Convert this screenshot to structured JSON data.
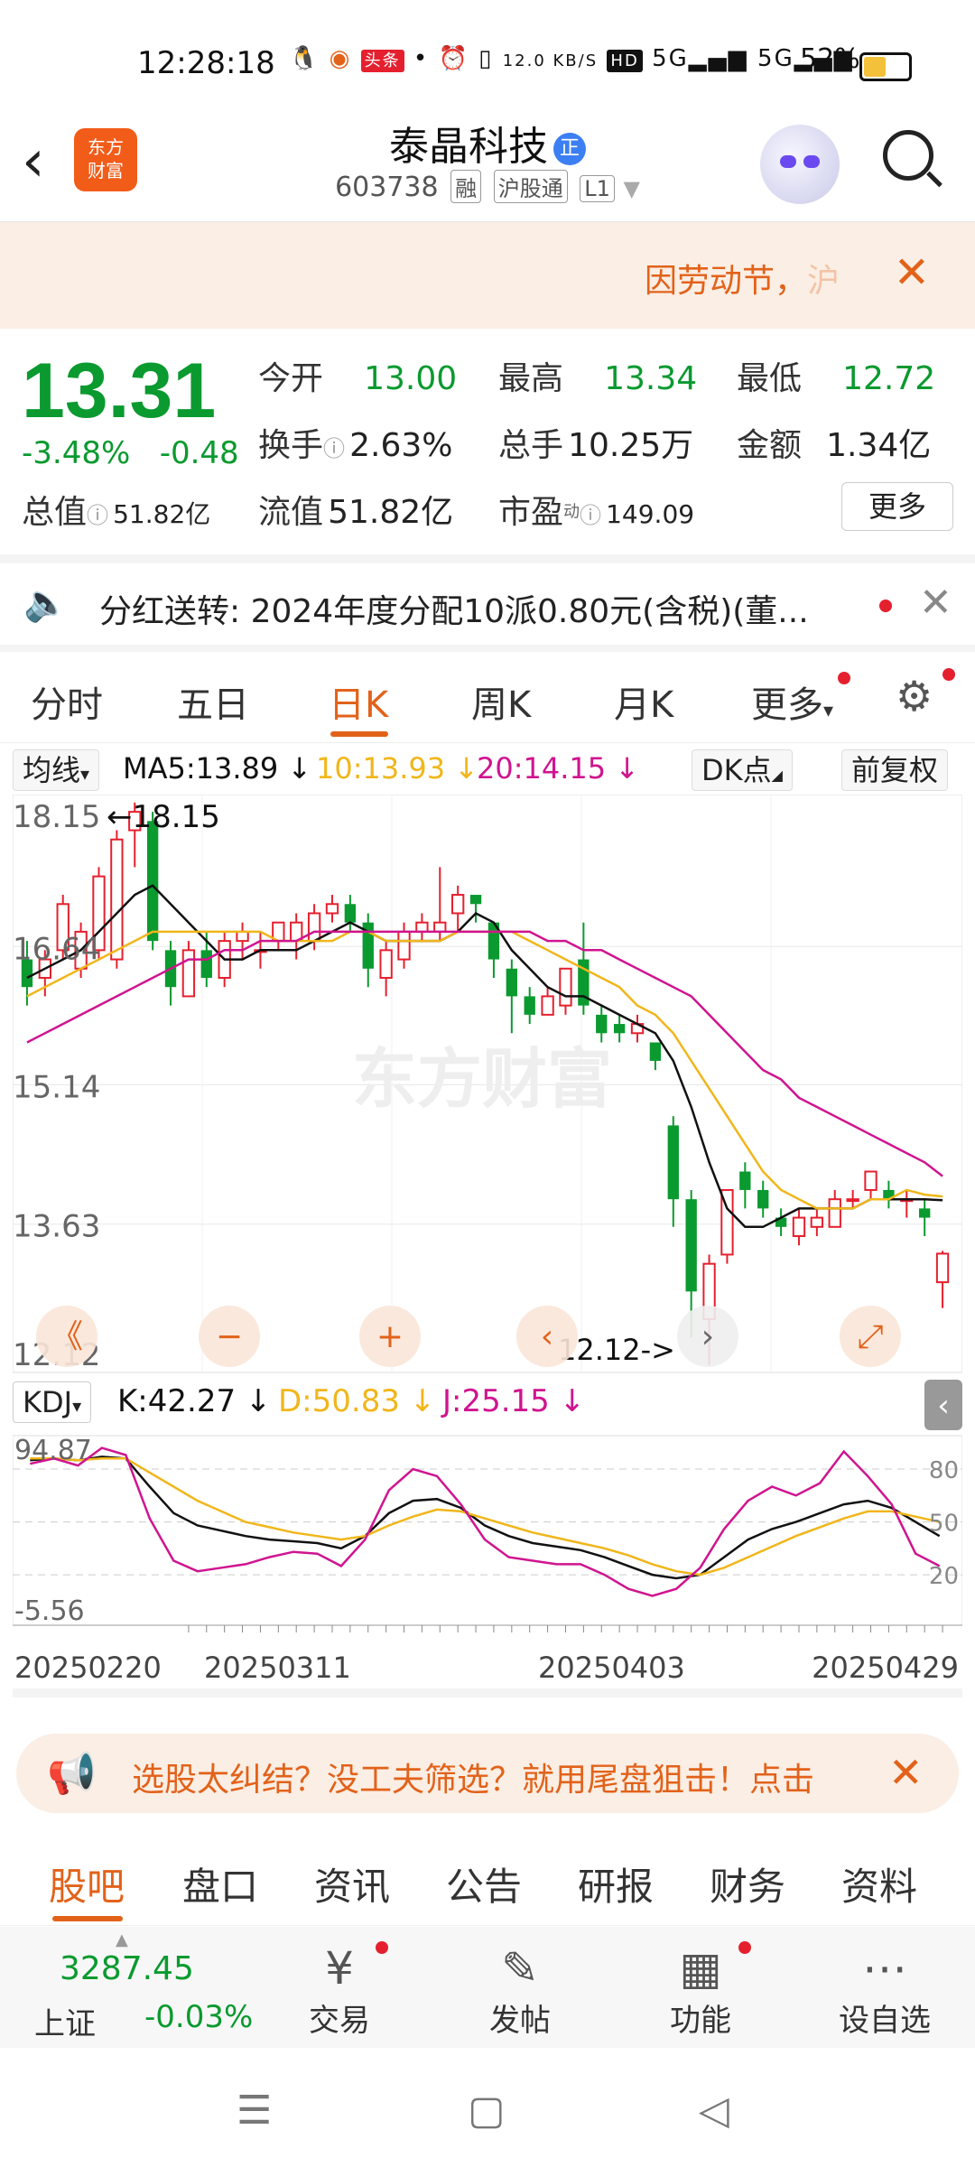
{
  "status_bar": {
    "time": "12:28:18",
    "net_speed": "12.0 KB/S",
    "battery": "52%",
    "battery_level": 0.52,
    "icons": [
      "qq-icon",
      "app-icon",
      "toutiao-icon",
      "dot-icon",
      "alarm-icon",
      "vibrate-icon",
      "hd-icon",
      "5g-icon",
      "5g-icon"
    ]
  },
  "header": {
    "stock_name": "泰晶科技",
    "badge": "正",
    "stock_code": "603738",
    "tags": [
      "融",
      "沪股通",
      "L1"
    ],
    "logo_line1": "东方",
    "logo_line2": "财富"
  },
  "notice": {
    "text": "因劳动节，",
    "text_cut": "沪"
  },
  "quote": {
    "price": "13.31",
    "change_pct": "-3.48%",
    "change": "-0.48",
    "open_label": "今开",
    "open": "13.00",
    "high_label": "最高",
    "high": "13.34",
    "low_label": "最低",
    "low": "12.72",
    "turnover_label": "换手",
    "turnover": "2.63%",
    "volume_label": "总手",
    "volume": "10.25万",
    "amount_label": "金额",
    "amount": "1.34亿",
    "mktcap_label": "总值",
    "mktcap": "51.82亿",
    "float_label": "流值",
    "float": "51.82亿",
    "pe_label": "市盈",
    "pe_sup": "动",
    "pe": "149.09",
    "more": "更多"
  },
  "dividend": {
    "label": "分红送转:",
    "text": "2024年度分配10派0.80元(含税)(董..."
  },
  "tabs": [
    "分时",
    "五日",
    "日K",
    "周K",
    "月K",
    "更多"
  ],
  "active_tab": "日K",
  "ma": {
    "selector": "均线",
    "ma5": "MA5:13.89",
    "ma10": "10:13.93",
    "ma20": "20:14.15",
    "dk": "DK点",
    "fq": "前复权"
  },
  "kdj": {
    "selector": "KDJ",
    "k": "K:42.27",
    "d": "D:50.83",
    "j": "J:25.15"
  },
  "colors": {
    "up": "#e5202e",
    "down": "#0a9a2f",
    "ma5": "#111111",
    "ma10": "#f0b61b",
    "ma20": "#d0148f",
    "accent": "#e2621a"
  },
  "chart_data": {
    "type": "candlestick",
    "y_ticks": [
      "18.15",
      "16.64",
      "15.14",
      "13.63",
      "12.12"
    ],
    "ylim": [
      12.12,
      18.15
    ],
    "max_label": "18.15",
    "min_label": "12.12->",
    "x_dates": [
      "20250220",
      "20250311",
      "20250403",
      "20250429"
    ],
    "kdj_ticks_left": [
      "94.87",
      "-5.56"
    ],
    "kdj_ticks_right": [
      "80",
      "50",
      "20"
    ],
    "watermark": "东方财富",
    "candles": [
      [
        16.5,
        16.2,
        16.7,
        16.0
      ],
      [
        16.3,
        16.5,
        16.6,
        16.1
      ],
      [
        16.6,
        17.1,
        17.2,
        16.5
      ],
      [
        16.4,
        16.8,
        16.9,
        16.3
      ],
      [
        16.6,
        17.4,
        17.5,
        16.5
      ],
      [
        16.5,
        17.8,
        17.9,
        16.4
      ],
      [
        17.9,
        18.1,
        18.2,
        17.5
      ],
      [
        18.0,
        16.7,
        18.1,
        16.6
      ],
      [
        16.6,
        16.2,
        16.7,
        16.0
      ],
      [
        16.1,
        16.6,
        16.7,
        16.1
      ],
      [
        16.6,
        16.3,
        16.8,
        16.2
      ],
      [
        16.3,
        16.7,
        16.8,
        16.2
      ],
      [
        16.7,
        16.8,
        16.9,
        16.5
      ],
      [
        16.6,
        16.6,
        16.8,
        16.4
      ],
      [
        16.7,
        16.9,
        16.9,
        16.6
      ],
      [
        16.7,
        16.9,
        17.0,
        16.5
      ],
      [
        16.7,
        17.0,
        17.1,
        16.6
      ],
      [
        17.0,
        17.1,
        17.2,
        16.9
      ],
      [
        17.1,
        16.9,
        17.2,
        16.8
      ],
      [
        16.9,
        16.4,
        17.0,
        16.2
      ],
      [
        16.3,
        16.6,
        16.7,
        16.1
      ],
      [
        16.5,
        16.8,
        16.9,
        16.4
      ],
      [
        16.8,
        16.9,
        17.0,
        16.7
      ],
      [
        16.8,
        16.9,
        17.5,
        16.7
      ],
      [
        17.0,
        17.2,
        17.3,
        16.8
      ],
      [
        17.2,
        17.1,
        17.2,
        16.9
      ],
      [
        16.9,
        16.5,
        16.9,
        16.3
      ],
      [
        16.4,
        16.1,
        16.5,
        15.7
      ],
      [
        16.1,
        15.9,
        16.2,
        15.8
      ],
      [
        15.9,
        16.1,
        16.2,
        15.9
      ],
      [
        16.0,
        16.4,
        16.4,
        15.9
      ],
      [
        16.5,
        16.0,
        16.9,
        15.9
      ],
      [
        15.9,
        15.7,
        16.0,
        15.6
      ],
      [
        15.8,
        15.7,
        15.9,
        15.6
      ],
      [
        15.7,
        15.8,
        15.9,
        15.6
      ],
      [
        15.6,
        15.4,
        15.6,
        15.3
      ],
      [
        14.7,
        13.9,
        14.8,
        13.6
      ],
      [
        13.9,
        12.9,
        14.0,
        12.4
      ],
      [
        12.6,
        13.2,
        13.3,
        12.1
      ],
      [
        13.3,
        14.0,
        14.0,
        13.2
      ],
      [
        14.2,
        14.0,
        14.3,
        13.8
      ],
      [
        14.0,
        13.8,
        14.1,
        13.7
      ],
      [
        13.7,
        13.6,
        13.8,
        13.5
      ],
      [
        13.5,
        13.7,
        13.8,
        13.4
      ],
      [
        13.6,
        13.7,
        13.8,
        13.5
      ],
      [
        13.6,
        13.9,
        14.0,
        13.6
      ],
      [
        13.9,
        13.9,
        14.0,
        13.8
      ],
      [
        14.0,
        14.2,
        14.2,
        13.9
      ],
      [
        14.0,
        13.9,
        14.1,
        13.8
      ],
      [
        13.9,
        13.9,
        14.0,
        13.7
      ],
      [
        13.8,
        13.7,
        13.9,
        13.5
      ],
      [
        13.0,
        13.31,
        13.34,
        12.72
      ]
    ],
    "ma_series": [
      {
        "name": "MA5",
        "values": [
          16.3,
          16.4,
          16.5,
          16.6,
          16.8,
          17.0,
          17.2,
          17.3,
          17.1,
          16.9,
          16.7,
          16.5,
          16.5,
          16.6,
          16.6,
          16.6,
          16.7,
          16.8,
          16.9,
          16.8,
          16.7,
          16.7,
          16.7,
          16.7,
          16.8,
          17.0,
          16.9,
          16.6,
          16.4,
          16.2,
          16.1,
          16.1,
          16.0,
          15.9,
          15.8,
          15.7,
          15.4,
          14.9,
          14.3,
          13.8,
          13.6,
          13.6,
          13.7,
          13.8,
          13.8,
          13.8,
          13.8,
          13.9,
          13.9,
          13.9,
          13.9,
          13.89
        ]
      },
      {
        "name": "10",
        "values": [
          16.1,
          16.2,
          16.3,
          16.4,
          16.5,
          16.6,
          16.7,
          16.8,
          16.8,
          16.8,
          16.8,
          16.8,
          16.8,
          16.8,
          16.7,
          16.7,
          16.7,
          16.7,
          16.8,
          16.8,
          16.7,
          16.7,
          16.7,
          16.7,
          16.8,
          16.8,
          16.8,
          16.8,
          16.7,
          16.6,
          16.5,
          16.4,
          16.3,
          16.2,
          16.0,
          15.9,
          15.7,
          15.4,
          15.1,
          14.8,
          14.5,
          14.2,
          14.0,
          13.9,
          13.8,
          13.8,
          13.8,
          13.9,
          13.9,
          14.0,
          13.95,
          13.93
        ]
      },
      {
        "name": "20",
        "values": [
          15.6,
          15.7,
          15.8,
          15.9,
          16.0,
          16.1,
          16.2,
          16.3,
          16.4,
          16.5,
          16.5,
          16.6,
          16.6,
          16.7,
          16.7,
          16.7,
          16.8,
          16.8,
          16.8,
          16.8,
          16.8,
          16.8,
          16.8,
          16.8,
          16.8,
          16.8,
          16.8,
          16.8,
          16.8,
          16.7,
          16.7,
          16.6,
          16.6,
          16.5,
          16.4,
          16.3,
          16.2,
          16.1,
          15.9,
          15.7,
          15.5,
          15.3,
          15.2,
          15.0,
          14.9,
          14.8,
          14.7,
          14.6,
          14.5,
          14.4,
          14.3,
          14.15
        ]
      }
    ],
    "kdj_series": [
      {
        "name": "K",
        "values": [
          85,
          86,
          85,
          87,
          86,
          70,
          55,
          48,
          45,
          42,
          40,
          39,
          38,
          35,
          42,
          55,
          62,
          63,
          58,
          48,
          42,
          38,
          36,
          34,
          30,
          25,
          20,
          18,
          20,
          30,
          40,
          46,
          50,
          55,
          60,
          62,
          58,
          50,
          42
        ]
      },
      {
        "name": "D",
        "values": [
          86,
          86,
          85,
          86,
          86,
          78,
          70,
          62,
          56,
          50,
          47,
          44,
          42,
          40,
          42,
          48,
          53,
          57,
          56,
          52,
          48,
          44,
          41,
          38,
          35,
          31,
          26,
          22,
          20,
          24,
          30,
          36,
          42,
          47,
          52,
          56,
          56,
          53,
          50
        ]
      },
      {
        "name": "J",
        "values": [
          83,
          86,
          82,
          92,
          88,
          52,
          28,
          22,
          24,
          26,
          30,
          33,
          32,
          25,
          40,
          68,
          80,
          76,
          60,
          40,
          30,
          28,
          26,
          26,
          20,
          12,
          8,
          12,
          24,
          46,
          62,
          70,
          65,
          72,
          90,
          76,
          60,
          32,
          25
        ]
      }
    ]
  },
  "chart_controls": [
    "《",
    "−",
    "+",
    "‹",
    "›",
    "⤢"
  ],
  "promo": {
    "text": "选股太纠结？没工夫筛选？就用尾盘狙击！点击"
  },
  "subtabs": [
    "股吧",
    "盘口",
    "资讯",
    "公告",
    "研报",
    "财务",
    "资料"
  ],
  "active_subtab": "股吧",
  "bottom": {
    "index_value": "3287.45",
    "index_name": "上证",
    "index_change": "-0.03%",
    "items": [
      {
        "label": "交易",
        "icon": "¥"
      },
      {
        "label": "发帖",
        "icon": "✎"
      },
      {
        "label": "功能",
        "icon": "▦"
      },
      {
        "label": "设自选",
        "icon": "⋯"
      }
    ]
  }
}
